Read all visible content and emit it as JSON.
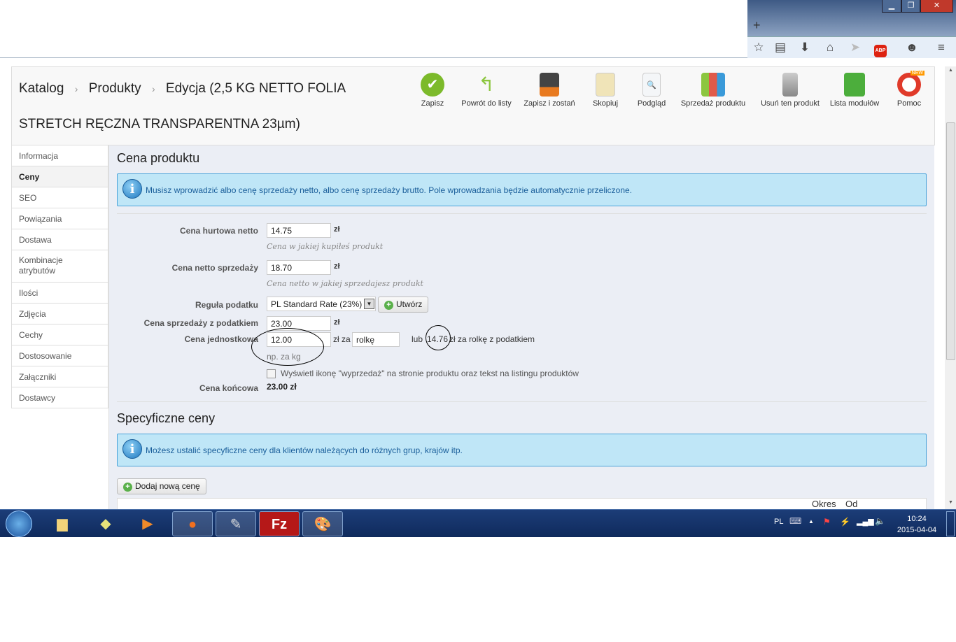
{
  "browser": {
    "new_tab": "+",
    "min": "▁",
    "max": "❐",
    "close": "✕",
    "icons": [
      "star-icon",
      "reading-list-icon",
      "download-icon",
      "home-icon",
      "send-icon",
      "adblock-icon",
      "chat-icon",
      "menu-icon"
    ],
    "abp": "ABP"
  },
  "breadcrumb": {
    "items": [
      "Katalog",
      "Produkty",
      "Edycja (2,5 KG NETTO FOLIA"
    ],
    "title_line2": "STRETCH RĘCZNA TRANSPARENTNA 23µm)"
  },
  "toolbar": [
    {
      "label": "Zapisz",
      "icon": "save-check-icon",
      "color": "#7cba2b"
    },
    {
      "label": "Powrót do listy",
      "icon": "back-arrow-icon",
      "color": "#8cc63f"
    },
    {
      "label": "Zapisz i zostań",
      "icon": "floppy-icon",
      "color": "#444"
    },
    {
      "label": "Skopiuj",
      "icon": "copy-icon",
      "color": "#e8d59a"
    },
    {
      "label": "Podgląd",
      "icon": "preview-icon",
      "color": "#dde6ee"
    },
    {
      "label": "Sprzedaż produktu",
      "icon": "bar-chart-icon",
      "color": "#e05a4a"
    },
    {
      "label": "Usuń ten produkt",
      "icon": "trash-icon",
      "color": "#999"
    },
    {
      "label": "Lista modułów",
      "icon": "puzzle-icon",
      "color": "#4cae3c"
    },
    {
      "label": "Pomoc",
      "icon": "lifebuoy-icon",
      "color": "#e03a2a",
      "badge": "NEW"
    }
  ],
  "sidebar": [
    "Informacja",
    "Ceny",
    "SEO",
    "Powiązania",
    "Dostawa",
    "Kombinacje atrybutów",
    "Ilości",
    "Zdjęcia",
    "Cechy",
    "Dostosowanie",
    "Załączniki",
    "Dostawcy"
  ],
  "price": {
    "title": "Cena produktu",
    "info": "Musisz wprowadzić albo cenę sprzedaży netto, albo cenę sprzedaży brutto. Pole wprowadzania będzie automatycznie przeliczone.",
    "wholesale_label": "Cena hurtowa netto",
    "wholesale": "14.75",
    "wholesale_hint": "Cena w jakiej kupiłeś produkt",
    "net_label": "Cena netto sprzedaży",
    "net": "18.70",
    "net_hint": "Cena netto w jakiej sprzedajesz produkt",
    "tax_label": "Reguła podatku",
    "tax": "PL Standard Rate (23%)",
    "create": "Utwórz",
    "gross_label": "Cena sprzedaży z podatkiem",
    "gross": "23.00",
    "unit_label": "Cena jednostkowa",
    "unit": "12.00",
    "unit_za": "zł za",
    "unit_name": "rolkę",
    "unit_hint": "np. za kg",
    "unit_or": "lub",
    "unit_tax": "14.76",
    "unit_tax_suffix": "zł za rolkę z podatkiem",
    "currency": "zł",
    "sale_checkbox": "Wyświetl ikonę \"wyprzedaż\" na stronie produktu oraz tekst na listingu produktów",
    "final_label": "Cena końcowa",
    "final": "23.00 zł"
  },
  "specific": {
    "title": "Specyficzne ceny",
    "info": "Możesz ustalić specyficzne ceny dla klientów należących do różnych grup, krajów itp.",
    "add": "Dodaj nową cenę",
    "col_period": "Okres",
    "col_from": "Od"
  },
  "taskbar": {
    "apps": [
      "windows-start",
      "file-explorer",
      "sticky-notes",
      "media-player",
      "firefox",
      "inkscape",
      "filezilla",
      "paint"
    ],
    "lang": "PL",
    "time": "10:24",
    "date": "2015-04-04"
  }
}
